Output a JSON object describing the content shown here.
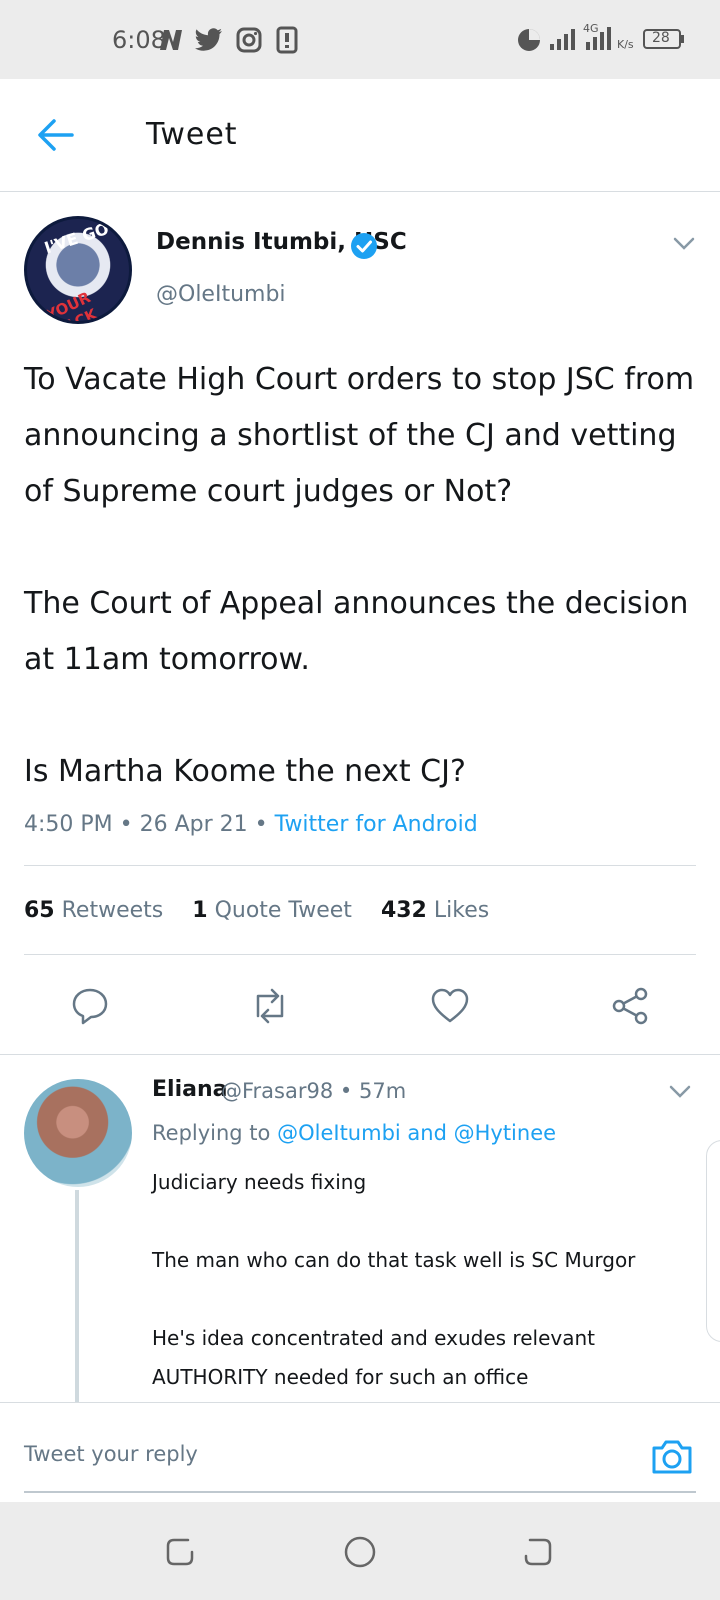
{
  "status_bar": {
    "time": "6:08",
    "network": "4G",
    "speed": "K/s",
    "battery": "28",
    "icons": [
      "notification-n-icon",
      "twitter-icon",
      "instagram-icon",
      "sim-icon",
      "data-saver-icon",
      "signal-icon",
      "battery-icon"
    ]
  },
  "header": {
    "title": "Tweet"
  },
  "tweet": {
    "author_name": "Dennis Itumbi, HSC",
    "author_handle": "@OleItumbi",
    "avatar_text_top": "I'VE GOT",
    "avatar_text_bottom": "YOUR BACK",
    "text": "To Vacate High Court orders to stop JSC from announcing a shortlist of the CJ and vetting of Supreme court judges or Not?\n\nThe Court of Appeal announces the decision at 11am tomorrow.\n\nIs Martha Koome the next CJ?",
    "time": "4:50 PM",
    "date": "26 Apr 21",
    "source": "Twitter for Android",
    "retweets_count": "65",
    "retweets_label": "Retweets",
    "quotes_count": "1",
    "quotes_label": "Quote Tweet",
    "likes_count": "432",
    "likes_label": "Likes"
  },
  "reply": {
    "name": "Eliana",
    "handle": "@Frasar98",
    "age": "57m",
    "replying_prefix": "Replying to",
    "replying_mentions": "@OleItumbi and @Hytinee",
    "text": "Judiciary needs fixing\n\nThe man who can do that task well is SC Murgor\n\nHe's idea concentrated and exudes relevant AUTHORITY needed for such an office"
  },
  "composer": {
    "placeholder": "Tweet your reply"
  },
  "colors": {
    "accent": "#1da1f2",
    "text": "#14171a",
    "secondary": "#657786",
    "divider": "#d8dde1"
  }
}
